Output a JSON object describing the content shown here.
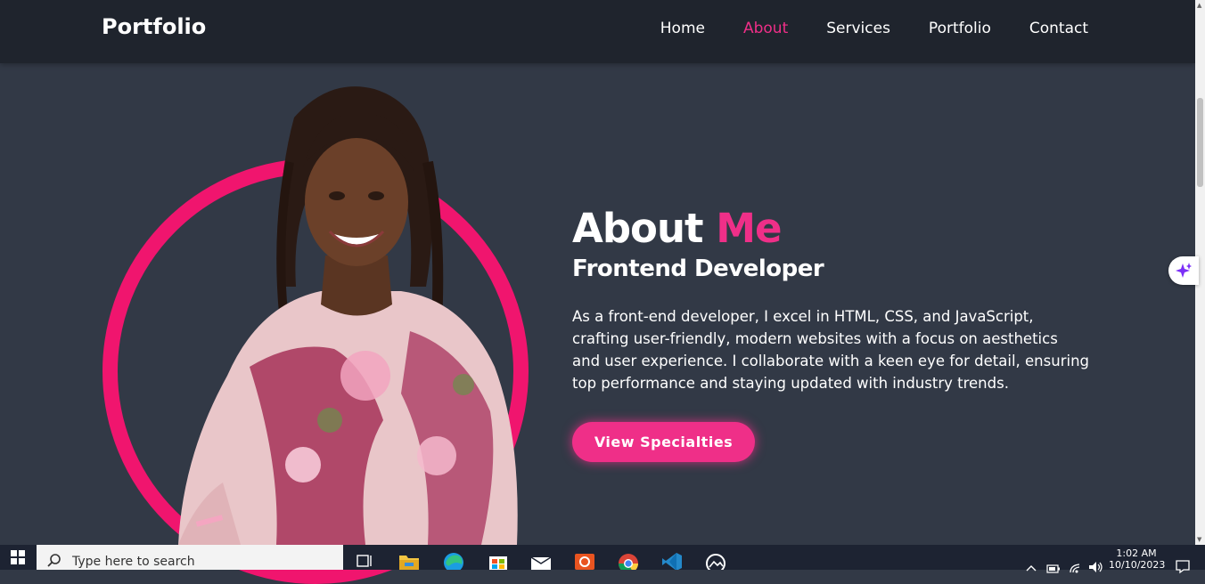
{
  "header": {
    "logo": "Portfolio",
    "nav": [
      {
        "label": "Home",
        "active": false
      },
      {
        "label": "About",
        "active": true
      },
      {
        "label": "Services",
        "active": false
      },
      {
        "label": "Portfolio",
        "active": false
      },
      {
        "label": "Contact",
        "active": false
      }
    ]
  },
  "about": {
    "heading_main": "About",
    "heading_accent": "Me",
    "subtitle": "Frontend Developer",
    "bio": "As a front-end developer, I excel in HTML, CSS, and JavaScript, crafting user-friendly, modern websites with a focus on aesthetics and user experience. I collaborate with a keen eye for detail, ensuring top performance and staying updated with industry trends.",
    "cta_label": "View Specialties"
  },
  "colors": {
    "accent": "#ef2f88",
    "ring": "#f0156e",
    "background": "#323946",
    "header": "#1f242d"
  },
  "taskbar": {
    "search_placeholder": "Type here to search",
    "time": "1:02 AM",
    "date": "10/10/2023",
    "pinned_icons": [
      "task-view-icon",
      "file-explorer-icon",
      "edge-icon",
      "store-icon",
      "mail-icon",
      "ubuntu-icon",
      "chrome-icon",
      "vscode-icon",
      "photos-icon"
    ]
  }
}
